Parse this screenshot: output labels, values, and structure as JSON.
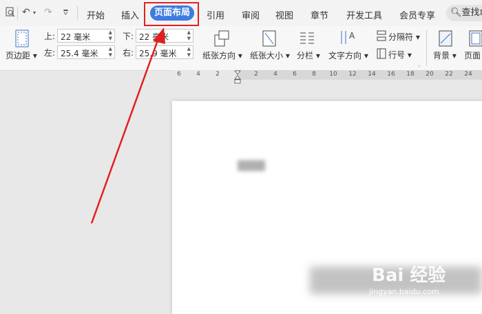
{
  "tabs": [
    "开始",
    "插入",
    "页面布局",
    "引用",
    "审阅",
    "视图",
    "章节",
    "开发工具",
    "会员专享"
  ],
  "search_label": "查找命",
  "margins": {
    "top_label": "上:",
    "top_value": "22 毫米",
    "bottom_label": "下:",
    "bottom_value": "22 毫米",
    "left_label": "左:",
    "left_value": "25.4 毫米",
    "right_label": "右:",
    "right_value": "25.9 毫米"
  },
  "ribbon": {
    "page_margins": "页边距",
    "orientation": "纸张方向",
    "paper_size": "纸张大小",
    "columns": "分栏",
    "text_direction": "文字方向",
    "separator": "分隔符",
    "line_numbers": "行号",
    "background": "背景",
    "page_border": "页面"
  },
  "ruler_ticks": [
    "6",
    "4",
    "2",
    "2",
    "4",
    "6",
    "8",
    "10",
    "12",
    "14",
    "16",
    "18",
    "20",
    "22",
    "24"
  ],
  "doc_text": "图 1",
  "watermark": {
    "brand": "Bai 经验",
    "url": "jingyan.baidu.com"
  }
}
